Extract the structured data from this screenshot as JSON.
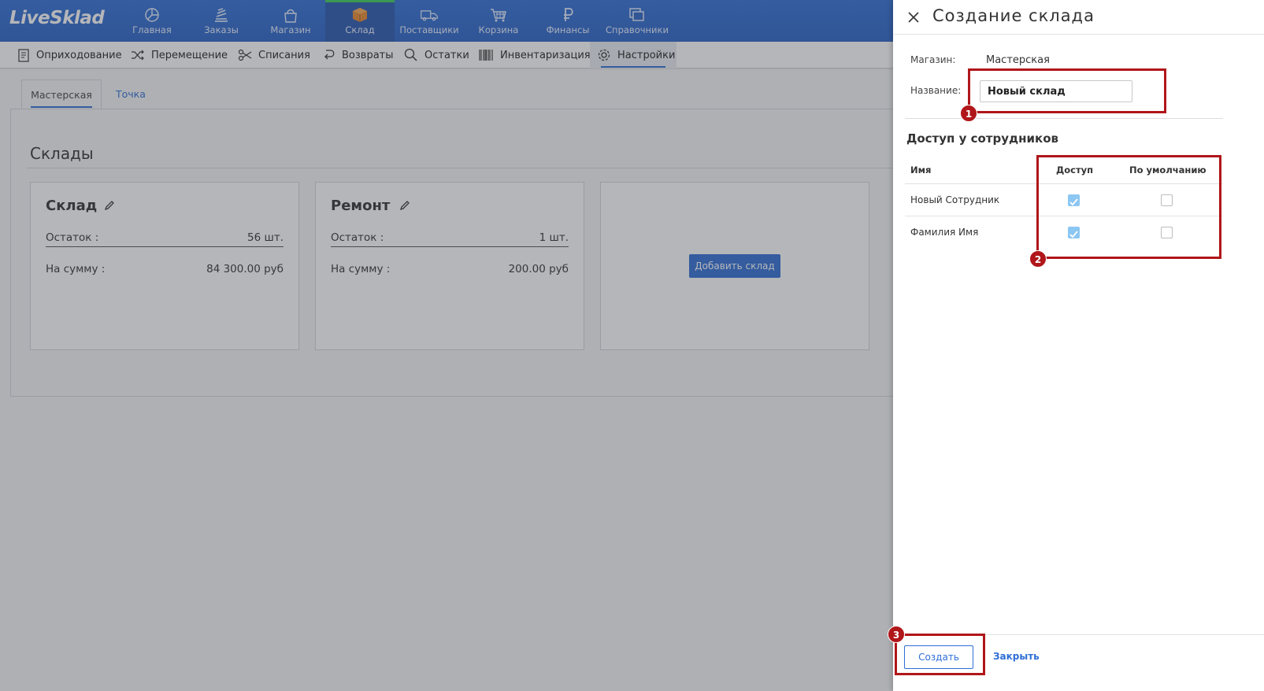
{
  "app": {
    "logo": "LiveSklad"
  },
  "nav": {
    "items": [
      {
        "label": "Главная",
        "icon": "pie-chart-icon"
      },
      {
        "label": "Заказы",
        "icon": "orders-icon"
      },
      {
        "label": "Магазин",
        "icon": "shop-bag-icon"
      },
      {
        "label": "Склад",
        "icon": "box-icon",
        "active": true
      },
      {
        "label": "Поставщики",
        "icon": "truck-icon"
      },
      {
        "label": "Корзина",
        "icon": "cart-icon"
      },
      {
        "label": "Финансы",
        "icon": "ruble-icon"
      },
      {
        "label": "Справочники",
        "icon": "books-icon"
      }
    ]
  },
  "subnav": {
    "items": [
      {
        "label": "Оприходование",
        "icon": "receipt-icon"
      },
      {
        "label": "Перемещение",
        "icon": "shuffle-icon"
      },
      {
        "label": "Списания",
        "icon": "scissors-icon"
      },
      {
        "label": "Возвраты",
        "icon": "return-icon"
      },
      {
        "label": "Остатки",
        "icon": "search-icon"
      },
      {
        "label": "Инвентаризация",
        "icon": "barcode-icon"
      },
      {
        "label": "Настройки",
        "icon": "gear-icon",
        "active": true
      }
    ]
  },
  "tabs": [
    {
      "label": "Мастерская",
      "active": true
    },
    {
      "label": "Точка приема/выдачи"
    }
  ],
  "section": {
    "title": "Склады"
  },
  "warehouses": [
    {
      "name": "Склад",
      "balance_label": "Остаток :",
      "balance": "56 шт.",
      "sum_label": "На сумму :",
      "sum": "84 300.00 руб"
    },
    {
      "name": "Ремонт",
      "balance_label": "Остаток :",
      "balance": "1 шт.",
      "sum_label": "На сумму :",
      "sum": "200.00 руб"
    }
  ],
  "add_warehouse_label": "Добавить склад",
  "drawer": {
    "title": "Создание склада",
    "shop_label": "Магазин:",
    "shop_value": "Мастерская",
    "name_label": "Название:",
    "name_value": "Новый склад",
    "access_title": "Доступ у сотрудников",
    "columns": {
      "name": "Имя",
      "access": "Доступ",
      "default": "По умолчанию"
    },
    "employees": [
      {
        "name": "Новый Сотрудник",
        "access": true,
        "default": false
      },
      {
        "name": "Фамилия Имя",
        "access": true,
        "default": false
      }
    ],
    "create_label": "Создать",
    "close_label": "Закрыть"
  },
  "annotations": [
    "1",
    "2",
    "3"
  ],
  "colors": {
    "primary": "#2f6fd6",
    "annotation": "#b0161a",
    "active_indicator": "#3bcf5a",
    "checked": "#8cc6f2"
  }
}
